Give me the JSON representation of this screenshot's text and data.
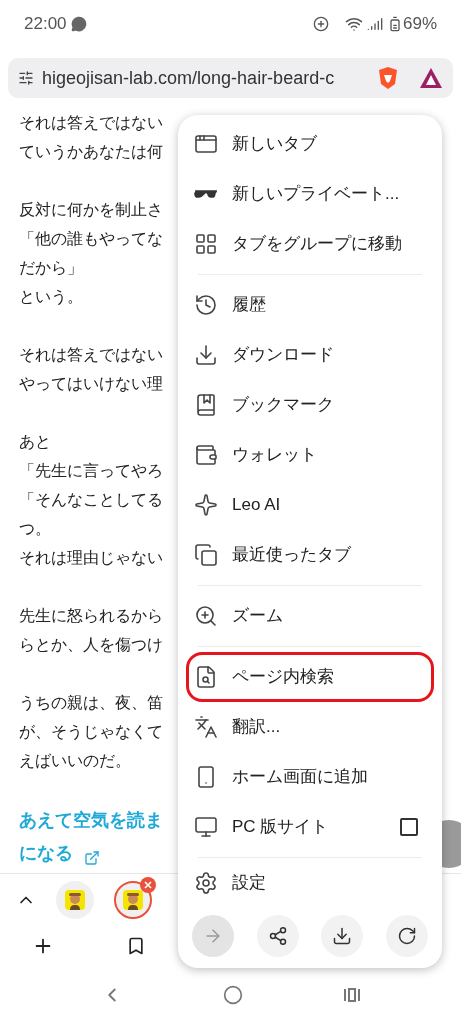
{
  "status_bar": {
    "time": "22:00",
    "battery": "69%"
  },
  "address_bar": {
    "url": "higeojisan-lab.com/long-hair-beard-c"
  },
  "article": {
    "paragraphs": [
      [
        "それは答えではない",
        "ていうかあなたは何"
      ],
      [
        "反対に何かを制止さ",
        "「他の誰もやってな",
        "だから」",
        "という。"
      ],
      [
        "それは答えではない",
        "やってはいけない理"
      ],
      [
        "あと",
        "「先生に言ってやろ",
        "「そんなことしてる",
        "つ。",
        "それは理由じゃない"
      ],
      [
        "先生に怒られるから",
        "らとか、人を傷つけ"
      ],
      [
        "うちの親は、夜、笛",
        "が、そうじゃなくて",
        "えばいいのだ。"
      ]
    ],
    "link_lines": [
      "あえて空気を読ま",
      "になる"
    ]
  },
  "tab_strip": {
    "tabs": [
      {
        "selected": false
      },
      {
        "selected": true
      }
    ]
  },
  "menu": {
    "items": [
      {
        "kind": "item",
        "label": "新しいタブ",
        "circled": false
      },
      {
        "kind": "item",
        "label": "新しいプライベート...",
        "circled": false
      },
      {
        "kind": "item",
        "label": "タブをグループに移動",
        "circled": false
      },
      {
        "kind": "divider"
      },
      {
        "kind": "item",
        "label": "履歴",
        "circled": false
      },
      {
        "kind": "item",
        "label": "ダウンロード",
        "circled": false
      },
      {
        "kind": "item",
        "label": "ブックマーク",
        "circled": false
      },
      {
        "kind": "item",
        "label": "ウォレット",
        "circled": false
      },
      {
        "kind": "item",
        "label": "Leo AI",
        "circled": false
      },
      {
        "kind": "item",
        "label": "最近使ったタブ",
        "circled": false
      },
      {
        "kind": "divider"
      },
      {
        "kind": "item",
        "label": "ズーム",
        "circled": false
      },
      {
        "kind": "divider"
      },
      {
        "kind": "item",
        "label": "ページ内検索",
        "circled": true
      },
      {
        "kind": "item",
        "label": "翻訳...",
        "circled": false
      },
      {
        "kind": "item",
        "label": "ホーム画面に追加",
        "circled": false
      },
      {
        "kind": "check",
        "label": "PC 版サイト",
        "checked": false,
        "circled": false
      },
      {
        "kind": "divider"
      },
      {
        "kind": "item",
        "label": "設定",
        "circled": false
      }
    ],
    "actions": [
      {
        "disabled": true
      },
      {
        "disabled": false
      },
      {
        "disabled": false
      },
      {
        "disabled": false
      }
    ]
  }
}
